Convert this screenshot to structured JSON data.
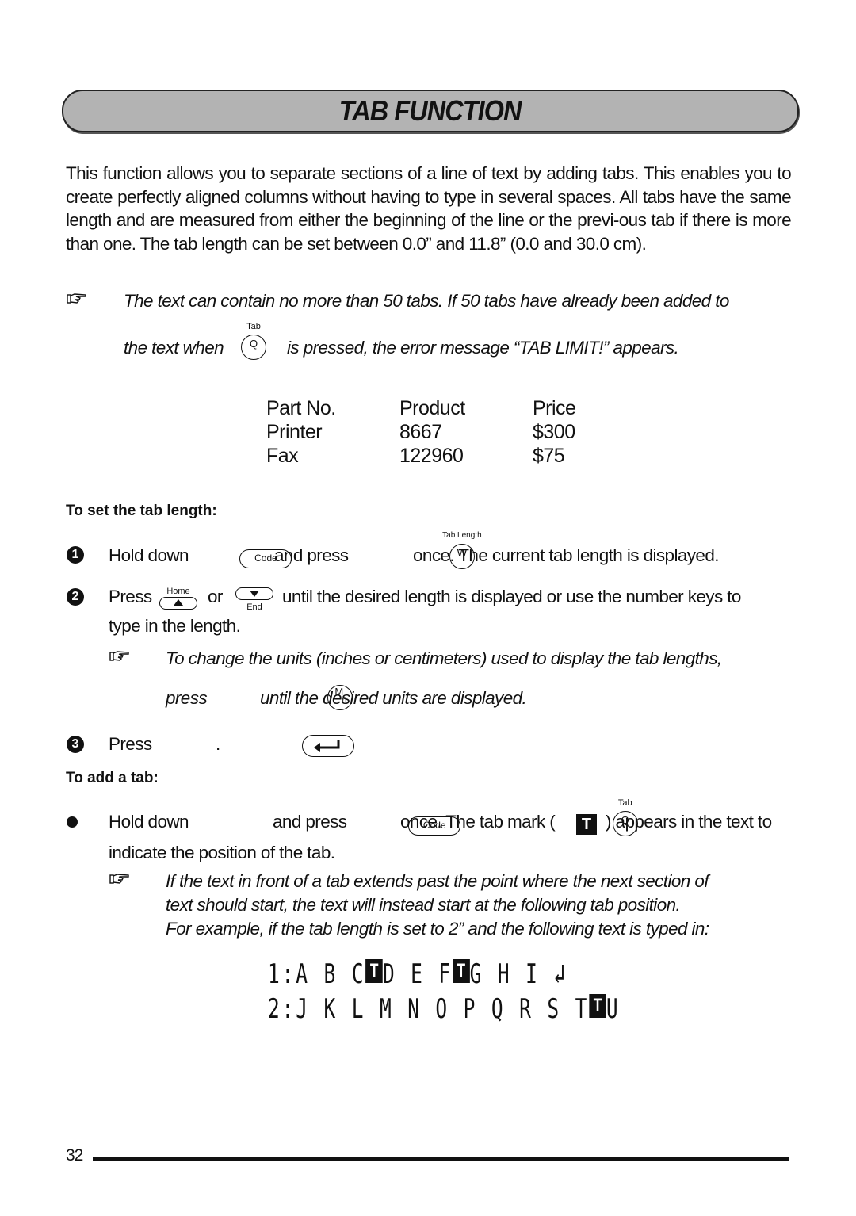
{
  "page": {
    "title": "TAB FUNCTION",
    "page_number": "32"
  },
  "intro": "This function allows you to separate sections of a line of text by adding tabs. This enables you to create perfectly aligned columns without having to type in several spaces. All tabs have the same length and are measured from either the beginning of the line or the previ-ous tab if there is more than one. The tab length can be set between 0.0” and 11.8” (0.0 and 30.0 cm).",
  "note1": {
    "icon": "pointing-hand-icon",
    "line1": "The text can contain no more than 50 tabs. If 50 tabs have already been added to",
    "line2_pre": "the text when",
    "key_label": "Q",
    "key_sup": "Tab",
    "line2_post": "is pressed, the error message “TAB LIMIT!” appears."
  },
  "sample_table": {
    "rows": [
      [
        "Part No.",
        "Product",
        "Price"
      ],
      [
        "Printer",
        "8667",
        "$300"
      ],
      [
        "Fax",
        "122960",
        "$75"
      ]
    ]
  },
  "set_tab_length": {
    "heading": "To set the tab length:",
    "step1": {
      "num": "1",
      "pre": "Hold down",
      "key1": "Code",
      "mid": "and press",
      "key2": "W",
      "key2_sup": "Tab Length",
      "post": "once. The current tab length is displayed."
    },
    "step2": {
      "num": "2",
      "pre": "Press",
      "key_up_label": "Home",
      "mid": "or",
      "key_down_label": "End",
      "post": "until the desired length is displayed or use the number keys to",
      "line2": "type in the length."
    },
    "note": {
      "icon": "pointing-hand-icon",
      "line1": "To change the units (inches or centimeters) used to display the tab lengths,",
      "line2_pre": "press",
      "key_main": "M",
      "key_sub": "ñ",
      "line2_post": "until the desired units are displayed."
    },
    "step3": {
      "num": "3",
      "pre": "Press",
      "post": "."
    }
  },
  "add_tab": {
    "heading": "To add a tab:",
    "bullet": {
      "pre": "Hold down",
      "key1": "Code",
      "mid": "and press",
      "key2": "Q",
      "key2_sup": "Tab",
      "post1": "once. The tab mark (",
      "tab_mark": "T",
      "post2": ") appears in the text to",
      "line2": "indicate the position of the tab."
    },
    "note": {
      "icon": "pointing-hand-icon",
      "line1": "If the text in front of a tab extends past the point where the next section of",
      "line2": "text should start, the text will instead start at the following tab position.",
      "line3": "For example, if the tab length is set to 2” and the following text is typed in:"
    }
  },
  "lcd_example": {
    "line1": {
      "prefix": "1:",
      "seg1": "A B C",
      "seg2": "D E F",
      "seg3": "G H I",
      "return_mark": "↲"
    },
    "line2": {
      "prefix": "2:",
      "seg1": "J K L M N O P Q R S T",
      "seg2": "U"
    },
    "tab_mark": "T"
  }
}
